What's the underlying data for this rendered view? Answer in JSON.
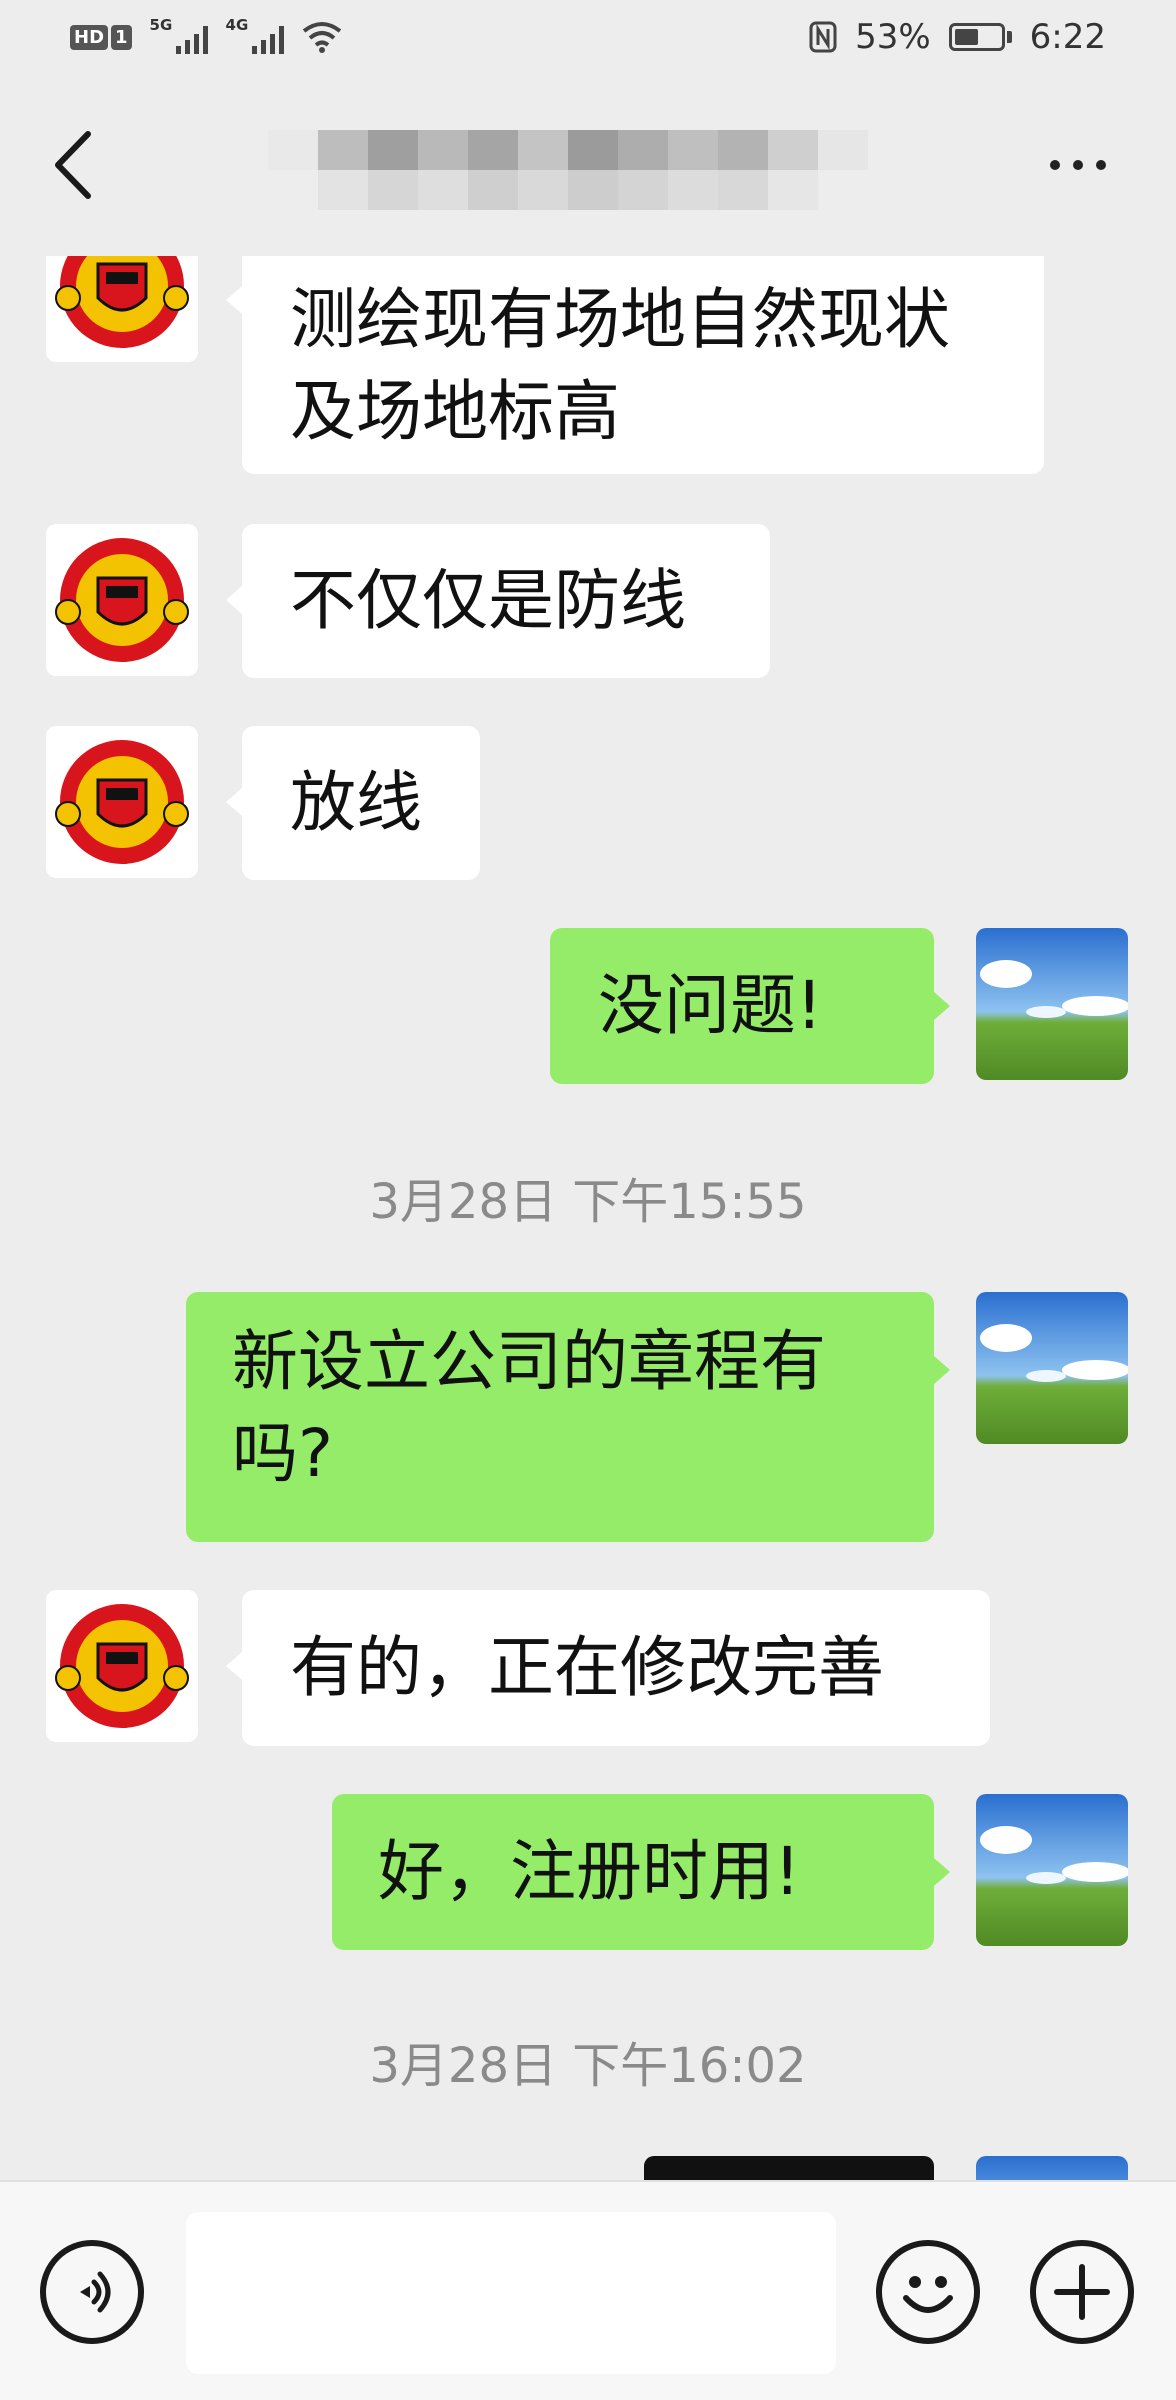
{
  "status_bar": {
    "hd_badge": "HD",
    "sim_badge": "1",
    "net1": "5G",
    "net2": "4G",
    "battery_pct": "53%",
    "time": "6:22",
    "battery_level": 0.53
  },
  "header": {
    "back_icon": "chevron-left-icon",
    "more_icon": "more-dots-icon"
  },
  "chat": {
    "messages": [
      {
        "dir": "in",
        "lines": [
          "测绘现有场地自然现状",
          "及场地标高"
        ]
      },
      {
        "dir": "in",
        "lines": [
          "不仅仅是防线"
        ]
      },
      {
        "dir": "in",
        "lines": [
          "放线"
        ]
      },
      {
        "dir": "out",
        "lines": [
          "没问题!"
        ]
      },
      {
        "dir": "out",
        "lines": [
          "新设立公司的章程有",
          "吗?"
        ]
      },
      {
        "dir": "in",
        "lines": [
          "有的，正在修改完善"
        ]
      },
      {
        "dir": "out",
        "lines": [
          "好，注册时用!"
        ]
      }
    ],
    "timestamps": [
      "3月28日 下午15:55",
      "3月28日 下午16:02"
    ],
    "avatar_in": "club-crest-avatar",
    "avatar_out": "landscape-avatar"
  },
  "input_bar": {
    "voice_icon": "voice-icon",
    "emoji_icon": "emoji-icon",
    "plus_icon": "plus-icon",
    "input_value": ""
  },
  "colors": {
    "bg": "#ededed",
    "bubble_out": "#95ec69",
    "bubble_in": "#ffffff"
  }
}
